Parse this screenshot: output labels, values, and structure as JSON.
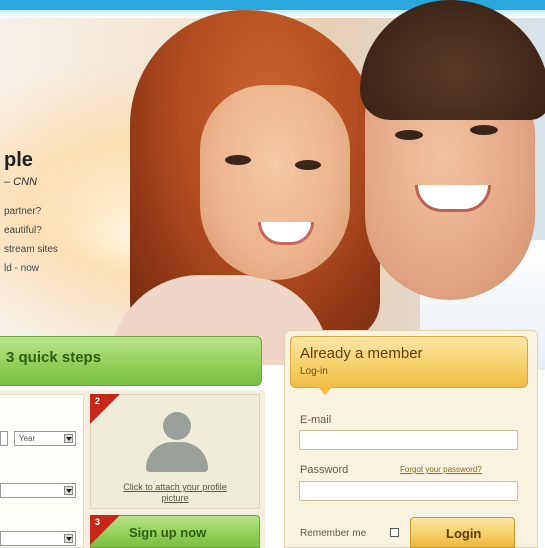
{
  "tagline": {
    "title": "ple",
    "source": "– CNN",
    "lines": [
      "partner?",
      "eautiful?",
      "stream sites",
      "ld - now"
    ]
  },
  "signup": {
    "steps_label": "3 quick steps",
    "year_select": "Year",
    "photo_step_number": "2",
    "attach_link": "Click to attach your profile picture",
    "signup_step_number": "3",
    "signup_button": "Sign up now"
  },
  "login": {
    "title": "Already a member",
    "subtitle": "Log-in",
    "email_label": "E-mail",
    "email_value": "",
    "password_label": "Password",
    "password_value": "",
    "forgot_link": "Forgot your password?",
    "remember_label": "Remember me",
    "login_button": "Login"
  },
  "colors": {
    "top_bar": "#2aa7dd",
    "green_accent": "#8fcf55",
    "gold_accent": "#f4cc5e",
    "step_badge": "#c7261b"
  }
}
